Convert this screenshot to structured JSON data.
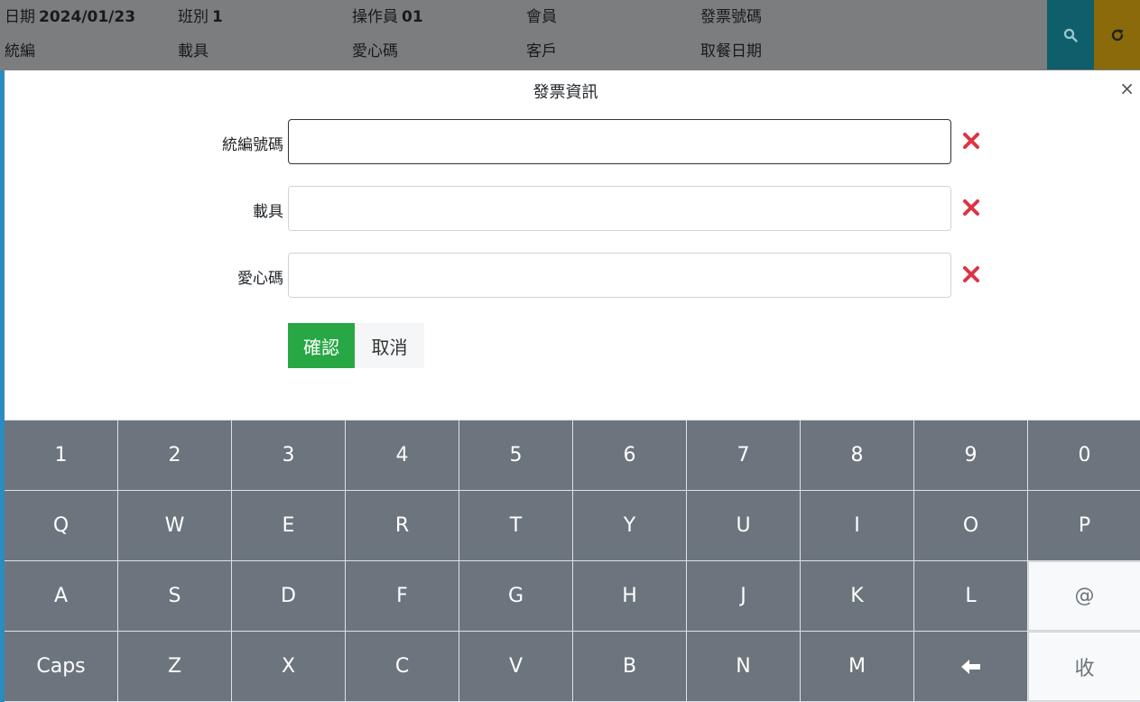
{
  "header": {
    "date_label": "日期",
    "date_value": "2024/01/23",
    "shift_label": "班別",
    "shift_value": "1",
    "operator_label": "操作員",
    "operator_value": "01",
    "member_label": "會員",
    "invoice_no_label": "發票號碼",
    "tax_id_label": "統編",
    "carrier_label": "載具",
    "donation_label": "愛心碼",
    "customer_label": "客戶",
    "pickup_date_label": "取餐日期"
  },
  "modal": {
    "title": "發票資訊",
    "close": "×",
    "fields": [
      {
        "label": "統編號碼",
        "value": ""
      },
      {
        "label": "載具",
        "value": ""
      },
      {
        "label": "愛心碼",
        "value": ""
      }
    ],
    "confirm_label": "確認",
    "cancel_label": "取消"
  },
  "keyboard": {
    "rows": [
      [
        "1",
        "2",
        "3",
        "4",
        "5",
        "6",
        "7",
        "8",
        "9",
        "0"
      ],
      [
        "Q",
        "W",
        "E",
        "R",
        "T",
        "Y",
        "U",
        "I",
        "O",
        "P"
      ],
      [
        "A",
        "S",
        "D",
        "F",
        "G",
        "H",
        "J",
        "K",
        "L",
        "@"
      ],
      [
        "Caps",
        "Z",
        "X",
        "C",
        "V",
        "B",
        "N",
        "M",
        "←",
        "收"
      ]
    ]
  },
  "icons": {
    "search": "search-icon",
    "refresh": "refresh-icon",
    "clear": "clear-x-icon",
    "backspace": "backspace-arrow-icon"
  },
  "colors": {
    "key_bg": "#6c757d",
    "confirm_green": "#28a745",
    "clear_red": "#dc3545",
    "search_teal": "#0f5e6b",
    "refresh_gold": "#8a6a0a"
  }
}
